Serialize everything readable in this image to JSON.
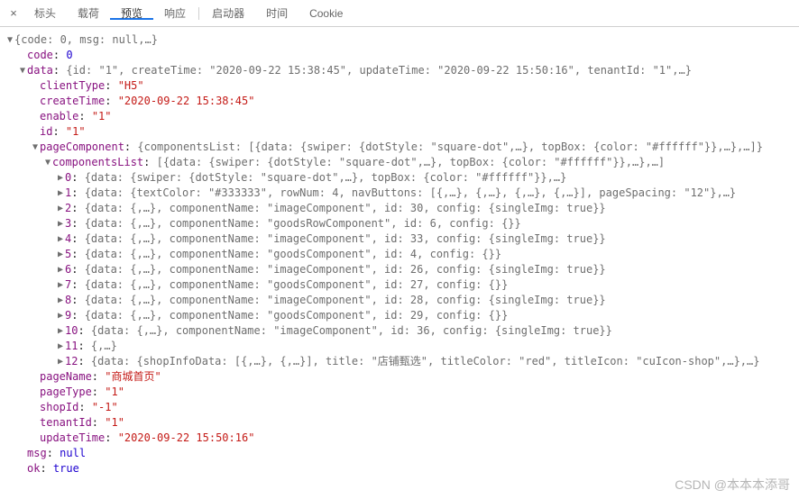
{
  "toolbar": {
    "close": "×",
    "tabs": [
      "标头",
      "载荷",
      "预览",
      "响应",
      "启动器",
      "时间",
      "Cookie"
    ],
    "activeIndex": 2
  },
  "watermark": "CSDN @本本本添哥",
  "lines": [
    {
      "i": 0,
      "a": "▼",
      "k": null,
      "v": "{code: 0, msg: null,…}",
      "t": "gray"
    },
    {
      "i": 1,
      "a": "",
      "k": "code",
      "v": "0",
      "t": "num"
    },
    {
      "i": 1,
      "a": "▼",
      "k": "data",
      "v": "{id: \"1\", createTime: \"2020-09-22 15:38:45\", updateTime: \"2020-09-22 15:50:16\", tenantId: \"1\",…}",
      "t": "gray"
    },
    {
      "i": 2,
      "a": "",
      "k": "clientType",
      "v": "\"H5\"",
      "t": "str"
    },
    {
      "i": 2,
      "a": "",
      "k": "createTime",
      "v": "\"2020-09-22 15:38:45\"",
      "t": "str"
    },
    {
      "i": 2,
      "a": "",
      "k": "enable",
      "v": "\"1\"",
      "t": "str"
    },
    {
      "i": 2,
      "a": "",
      "k": "id",
      "v": "\"1\"",
      "t": "str"
    },
    {
      "i": 2,
      "a": "▼",
      "k": "pageComponent",
      "v": "{componentsList: [{data: {swiper: {dotStyle: \"square-dot\",…}, topBox: {color: \"#ffffff\"}},…},…]}",
      "t": "gray"
    },
    {
      "i": 3,
      "a": "▼",
      "k": "componentsList",
      "v": "[{data: {swiper: {dotStyle: \"square-dot\",…}, topBox: {color: \"#ffffff\"}},…},…]",
      "t": "gray"
    },
    {
      "i": 4,
      "a": "▶",
      "k": "0",
      "v": "{data: {swiper: {dotStyle: \"square-dot\",…}, topBox: {color: \"#ffffff\"}},…}",
      "t": "gray"
    },
    {
      "i": 4,
      "a": "▶",
      "k": "1",
      "v": "{data: {textColor: \"#333333\", rowNum: 4, navButtons: [{,…}, {,…}, {,…}, {,…}], pageSpacing: \"12\"},…}",
      "t": "gray"
    },
    {
      "i": 4,
      "a": "▶",
      "k": "2",
      "v": "{data: {,…}, componentName: \"imageComponent\", id: 30, config: {singleImg: true}}",
      "t": "gray"
    },
    {
      "i": 4,
      "a": "▶",
      "k": "3",
      "v": "{data: {,…}, componentName: \"goodsRowComponent\", id: 6, config: {}}",
      "t": "gray"
    },
    {
      "i": 4,
      "a": "▶",
      "k": "4",
      "v": "{data: {,…}, componentName: \"imageComponent\", id: 33, config: {singleImg: true}}",
      "t": "gray"
    },
    {
      "i": 4,
      "a": "▶",
      "k": "5",
      "v": "{data: {,…}, componentName: \"goodsComponent\", id: 4, config: {}}",
      "t": "gray"
    },
    {
      "i": 4,
      "a": "▶",
      "k": "6",
      "v": "{data: {,…}, componentName: \"imageComponent\", id: 26, config: {singleImg: true}}",
      "t": "gray"
    },
    {
      "i": 4,
      "a": "▶",
      "k": "7",
      "v": "{data: {,…}, componentName: \"goodsComponent\", id: 27, config: {}}",
      "t": "gray"
    },
    {
      "i": 4,
      "a": "▶",
      "k": "8",
      "v": "{data: {,…}, componentName: \"imageComponent\", id: 28, config: {singleImg: true}}",
      "t": "gray"
    },
    {
      "i": 4,
      "a": "▶",
      "k": "9",
      "v": "{data: {,…}, componentName: \"goodsComponent\", id: 29, config: {}}",
      "t": "gray"
    },
    {
      "i": 4,
      "a": "▶",
      "k": "10",
      "v": "{data: {,…}, componentName: \"imageComponent\", id: 36, config: {singleImg: true}}",
      "t": "gray"
    },
    {
      "i": 4,
      "a": "▶",
      "k": "11",
      "v": "{,…}",
      "t": "gray"
    },
    {
      "i": 4,
      "a": "▶",
      "k": "12",
      "v": "{data: {shopInfoData: [{,…}, {,…}], title: \"店铺甄选\", titleColor: \"red\", titleIcon: \"cuIcon-shop\",…},…}",
      "t": "gray"
    },
    {
      "i": 2,
      "a": "",
      "k": "pageName",
      "v": "\"商城首页\"",
      "t": "str"
    },
    {
      "i": 2,
      "a": "",
      "k": "pageType",
      "v": "\"1\"",
      "t": "str"
    },
    {
      "i": 2,
      "a": "",
      "k": "shopId",
      "v": "\"-1\"",
      "t": "str"
    },
    {
      "i": 2,
      "a": "",
      "k": "tenantId",
      "v": "\"1\"",
      "t": "str"
    },
    {
      "i": 2,
      "a": "",
      "k": "updateTime",
      "v": "\"2020-09-22 15:50:16\"",
      "t": "str"
    },
    {
      "i": 1,
      "a": "",
      "k": "msg",
      "v": "null",
      "t": "null"
    },
    {
      "i": 1,
      "a": "",
      "k": "ok",
      "v": "true",
      "t": "bool"
    }
  ]
}
